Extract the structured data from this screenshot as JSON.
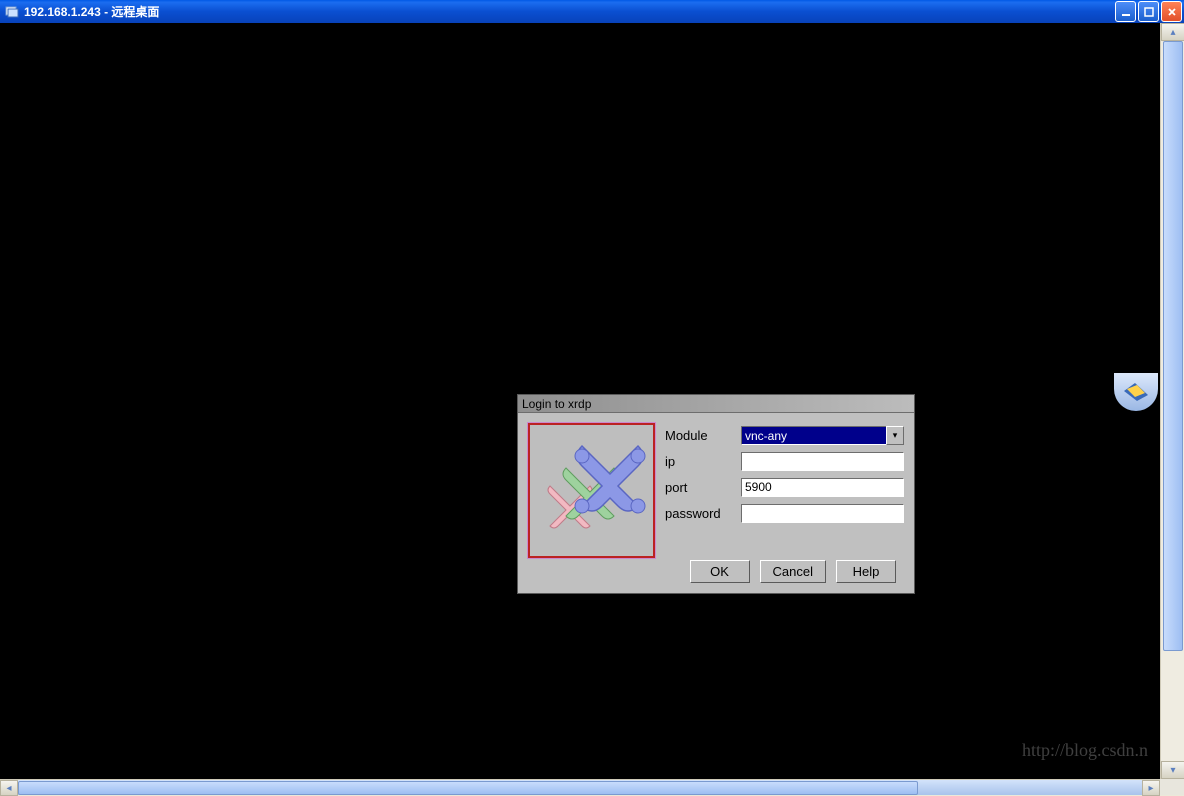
{
  "window": {
    "title": "192.168.1.243 - 远程桌面"
  },
  "dialog": {
    "title": "Login to xrdp",
    "fields": {
      "module_label": "Module",
      "module_value": "vnc-any",
      "ip_label": "ip",
      "ip_value": "",
      "port_label": "port",
      "port_value": "5900",
      "password_label": "password",
      "password_value": ""
    },
    "buttons": {
      "ok": "OK",
      "cancel": "Cancel",
      "help": "Help"
    }
  },
  "watermark": "http://blog.csdn.n"
}
